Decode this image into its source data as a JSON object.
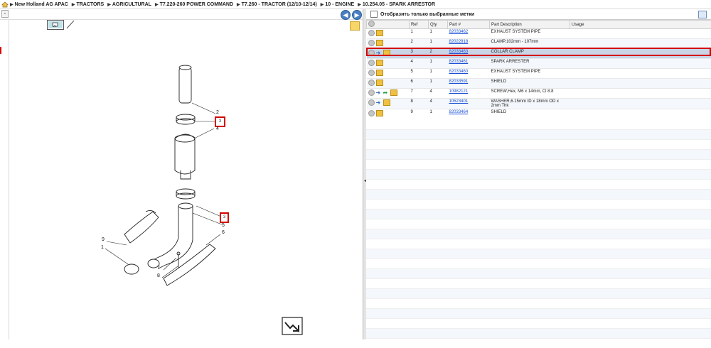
{
  "breadcrumb": [
    "New Holland AG APAC",
    "TRACTORS",
    "AGRICULTURAL",
    "T7.220-260 POWER COMMAND",
    "T7.260 - TRACTOR (12/10-12/14)",
    "10 - ENGINE",
    "10.254.05 - SPARK ARRESTOR"
  ],
  "filter_label": "Отобразить только выбранные метки",
  "columns": [
    "Ref",
    "Qty",
    "Part #",
    "Part Description",
    "Usage"
  ],
  "rows": [
    {
      "ref": "1",
      "qty": "1",
      "part": "82033462",
      "desc": "EXHAUST SYSTEM PIPE",
      "usage": "",
      "icons": [
        "grey",
        "box"
      ]
    },
    {
      "ref": "2",
      "qty": "1",
      "part": "82022918",
      "desc": "CLAMP,102mm - 107mm",
      "usage": "",
      "icons": [
        "grey",
        "box"
      ]
    },
    {
      "ref": "3",
      "qty": "2",
      "part": "82033463",
      "desc": "COLLAR CLAMP",
      "usage": "",
      "icons": [
        "grey",
        "arrow",
        "box"
      ],
      "selected": true
    },
    {
      "ref": "4",
      "qty": "1",
      "part": "82033461",
      "desc": "SPARK ARRESTER",
      "usage": "",
      "icons": [
        "grey",
        "box"
      ]
    },
    {
      "ref": "5",
      "qty": "1",
      "part": "82033460",
      "desc": "EXHAUST SYSTEM PIPE",
      "usage": "",
      "icons": [
        "grey",
        "box"
      ]
    },
    {
      "ref": "6",
      "qty": "1",
      "part": "82033591",
      "desc": "SHIELD",
      "usage": "",
      "icons": [
        "grey",
        "box"
      ]
    },
    {
      "ref": "7",
      "qty": "4",
      "part": "10982121",
      "desc": "SCREW,Hex, M6 x 14mm, Cl 8.8",
      "usage": "",
      "icons": [
        "grey",
        "arrow",
        "green",
        "box"
      ]
    },
    {
      "ref": "8",
      "qty": "4",
      "part": "10523401",
      "desc": "WASHER,6.15mm ID x 18mm OD x 2mm Thk",
      "usage": "",
      "icons": [
        "grey",
        "arrow",
        "box"
      ]
    },
    {
      "ref": "9",
      "qty": "1",
      "part": "82033464",
      "desc": "SHIELD",
      "usage": "",
      "icons": [
        "grey",
        "box"
      ]
    }
  ],
  "callouts": {
    "c1": "1",
    "c2": "2",
    "c3": "3",
    "c4": "4",
    "c5": "5",
    "c6": "6",
    "c7": "7",
    "c8": "8",
    "c9": "9",
    "hl_a": "3",
    "hl_b": "3"
  }
}
